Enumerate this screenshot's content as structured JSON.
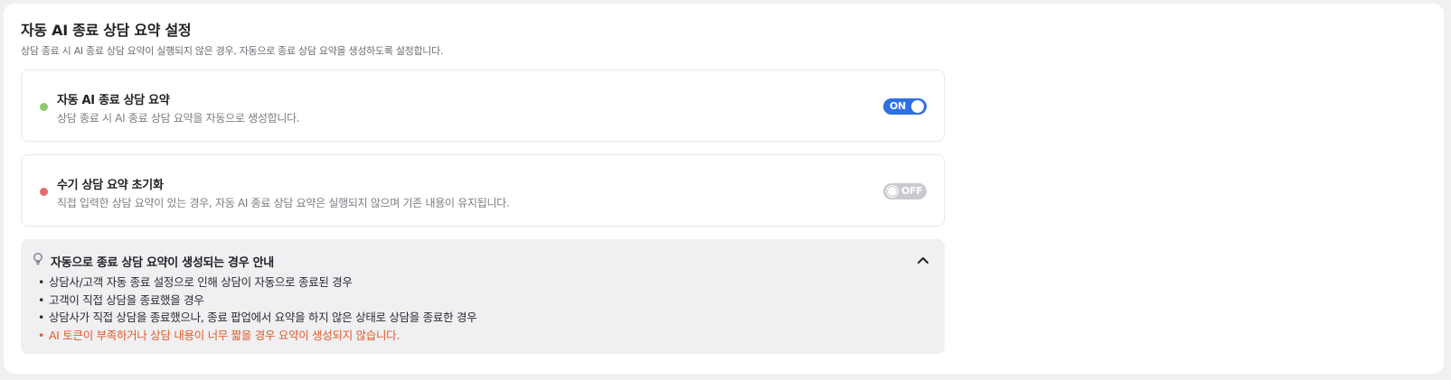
{
  "section": {
    "title": "자동 AI 종료 상담 요약 설정",
    "description": "상담 종료 시 AI 종료 상담 요약이 실행되지 않은 경우, 자동으로 종료 상담 요약을 생성하도록 설정합니다."
  },
  "settings": [
    {
      "title": "자동 AI 종료 상담 요약",
      "description": "상담 종료 시 AI 종료 상담 요약을 자동으로 생성합니다.",
      "toggle_label": "ON",
      "status_color": "#8cc96b",
      "enabled": true
    },
    {
      "title": "수기 상담 요약 초기화",
      "description": "직접 입력한 상담 요약이 있는 경우, 자동 AI 종료 상담 요약은 실행되지 않으며 기존 내용이 유지됩니다.",
      "toggle_label": "OFF",
      "status_color": "#e56a6e",
      "enabled": false
    }
  ],
  "info": {
    "title": "자동으로 종료 상담 요약이 생성되는 경우 안내",
    "icon": "lightbulb-icon",
    "collapse_icon": "chevron-up-icon",
    "bullet": "•",
    "items": [
      "상담사/고객 자동 종료 설정으로 인해 상담이 자동으로 종료된 경우",
      "고객이 직접 상담을 종료했을 경우",
      "상담사가 직접 상담을 종료했으나, 종료 팝업에서 요약을 하지 않은 상태로 상담을 종료한 경우"
    ],
    "warning": "AI 토큰이 부족하거나 상담 내용이 너무 짧을 경우 요약이 생성되지 않습니다."
  },
  "colors": {
    "accent": "#2f6fe4",
    "toggle_off": "#c9cacf",
    "warning": "#e25a2b"
  }
}
